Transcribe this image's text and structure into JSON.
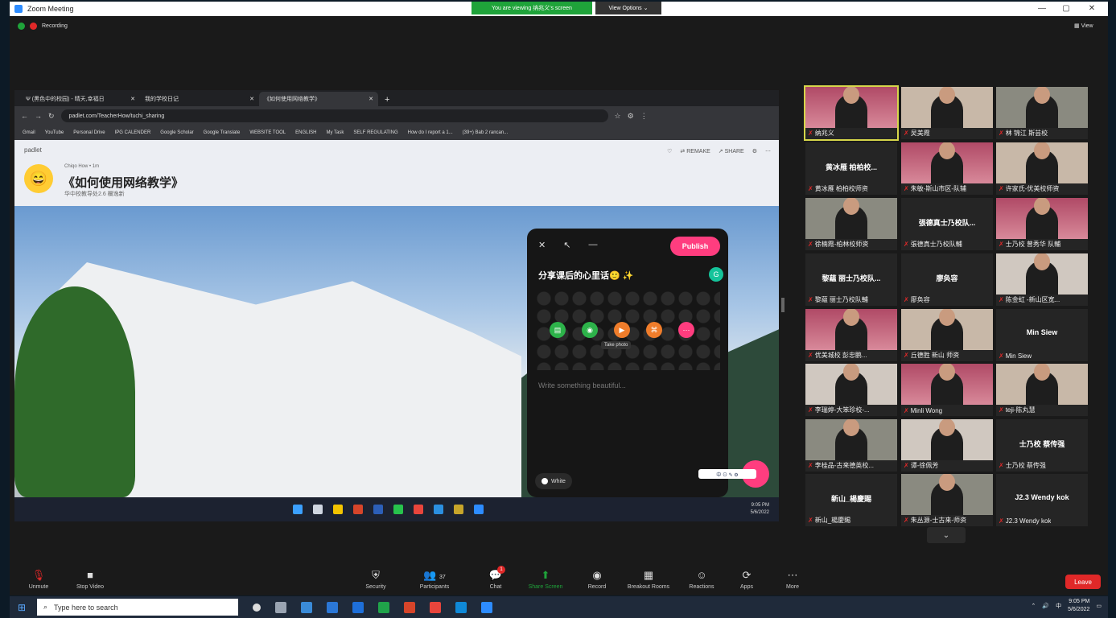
{
  "window": {
    "title": "Zoom Meeting",
    "min": "—",
    "max": "▢",
    "close": "✕"
  },
  "banner": {
    "viewing": "You are viewing 纳兆义's screen",
    "view_options": "View Options ⌄"
  },
  "meeting": {
    "recording": "Recording",
    "view": "View"
  },
  "browser": {
    "tabs": [
      {
        "label": "Ψ (黑色中的校园) - 晴天,幸福日",
        "close": "✕"
      },
      {
        "label": "我的学校日记",
        "close": "✕"
      },
      {
        "label": "《如何使用网络教学》",
        "close": "✕"
      }
    ],
    "new_tab": "+",
    "url": "padlet.com/TeacherHow/tuchi_sharing",
    "bookmarks": [
      "Gmail",
      "YouTube",
      "Personal Drive",
      "IPG CALENDER",
      "Google Scholar",
      "Google Translate",
      "WEBSITE TOOL",
      "ENGLISH",
      "My Task",
      "SELF REGULATING",
      "How do I report a 1...",
      "(39+) Bab 2 rancan..."
    ]
  },
  "padlet": {
    "logo": "padlet",
    "author": "Chiqo How • 1m",
    "title": "《如何使用网络教学》",
    "subtitle": "华中校教导处2.6 欄逸新",
    "actions": [
      "♡",
      "⇄ REMAKE",
      "↗ SHARE",
      "⚙",
      "⋯"
    ],
    "emoji": "😄"
  },
  "composer": {
    "close": "✕",
    "expand": "↖",
    "minimize": "—",
    "publish": "Publish",
    "title": "分享课后的心里话🙂 ✨",
    "grammarly": "G",
    "tooltip": "Take photo",
    "body_placeholder": "Write something beautiful...",
    "color_label": "White"
  },
  "input_tools": "中 ⊙ ✎ ⚙",
  "inner_taskbar": {
    "time": "9:05 PM",
    "date": "5/6/2022"
  },
  "participants": [
    {
      "name": "纳兆义",
      "big": ""
    },
    {
      "name": "吴美霞",
      "big": ""
    },
    {
      "name": "林 锦江 斯芸校",
      "big": ""
    },
    {
      "name": "黄冰雁 柏柏校师资",
      "big": "黄冰雁 柏柏校..."
    },
    {
      "name": "朱敏-斯山市区-队辅",
      "big": ""
    },
    {
      "name": "许家氏-优美校师资",
      "big": ""
    },
    {
      "name": "徐楠霞-柏林校师资",
      "big": ""
    },
    {
      "name": "張德真士乃校队輔",
      "big": "張德真士乃校队..."
    },
    {
      "name": "士乃校 曾秀华 队輔",
      "big": ""
    },
    {
      "name": "黎蘊 丽士乃校队輔",
      "big": "黎蘊 丽士乃校队..."
    },
    {
      "name": "廖奂容",
      "big": "廖奂容"
    },
    {
      "name": "陈金虹 -新山区宽...",
      "big": ""
    },
    {
      "name": "优美城校 彭忠鹏...",
      "big": ""
    },
    {
      "name": "丘德胜 新山 师资",
      "big": ""
    },
    {
      "name": "Min Siew",
      "big": "Min Siew"
    },
    {
      "name": "李瑞婷-大笨珍校-...",
      "big": ""
    },
    {
      "name": "Minli Wong",
      "big": ""
    },
    {
      "name": "teji-陈丸慧",
      "big": ""
    },
    {
      "name": "李桂品-古来德英校...",
      "big": ""
    },
    {
      "name": "谭-徐佩芳",
      "big": ""
    },
    {
      "name": "士乃校 蔡传强",
      "big": "士乃校 蔡传强"
    },
    {
      "name": "新山_楊慶賜",
      "big": "新山_楊慶賜"
    },
    {
      "name": "朱丛源-士古来-师资",
      "big": ""
    },
    {
      "name": "J2.3 Wendy kok",
      "big": "J2.3 Wendy kok"
    }
  ],
  "gallery_next": "⌄",
  "toolbar": {
    "unmute": "Unmute",
    "stop_video": "Stop Video",
    "security": "Security",
    "participants": "Participants",
    "participant_count": "37",
    "chat": "Chat",
    "chat_badge": "1",
    "share_screen": "Share Screen",
    "record": "Record",
    "breakout": "Breakout Rooms",
    "reactions": "Reactions",
    "apps": "Apps",
    "more": "More",
    "leave": "Leave"
  },
  "taskbar": {
    "search_placeholder": "Type here to search",
    "time": "9:05 PM",
    "date": "5/6/2022",
    "ime": "中"
  },
  "colors": {
    "accent": "#ff3d7f",
    "zoom_green": "#1fa33a",
    "leave_red": "#e02828",
    "active_speaker": "#d6d64a"
  }
}
